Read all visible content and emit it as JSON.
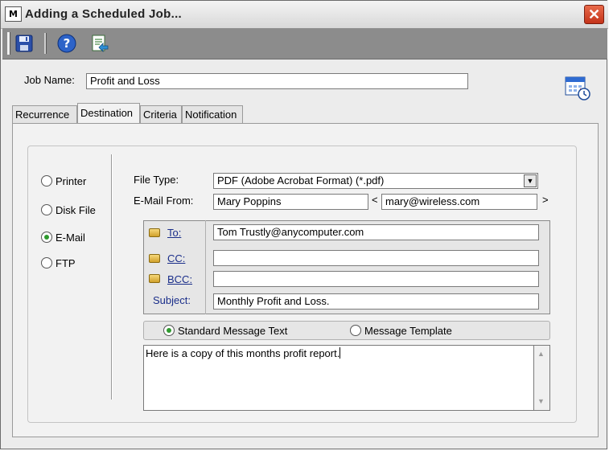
{
  "window": {
    "title": "Adding a Scheduled Job...",
    "app_icon_text": "M",
    "close_glyph": "✕"
  },
  "toolbar": {
    "buttons": [
      {
        "name": "save-icon",
        "tooltip": ""
      },
      {
        "name": "help-icon",
        "tooltip": ""
      },
      {
        "name": "export-icon",
        "tooltip": ""
      }
    ]
  },
  "job": {
    "label": "Job Name:",
    "value": "Profit and Loss"
  },
  "tabs": [
    {
      "label": "Recurrence",
      "active": false
    },
    {
      "label": "Destination",
      "active": true
    },
    {
      "label": "Criteria",
      "active": false
    },
    {
      "label": "Notification",
      "active": false
    }
  ],
  "destination": {
    "options": [
      {
        "label": "Printer",
        "checked": false
      },
      {
        "label": "Disk File",
        "checked": false
      },
      {
        "label": "E-Mail",
        "checked": true
      },
      {
        "label": "FTP",
        "checked": false
      }
    ]
  },
  "file_type": {
    "label": "File Type:",
    "value": "PDF (Adobe Acrobat Format) (*.pdf)"
  },
  "email_from": {
    "label": "E-Mail From:",
    "name": "Mary Poppins",
    "open_bracket": "<",
    "address": "mary@wireless.com",
    "close_bracket": ">"
  },
  "recipients": {
    "to": {
      "label": "To:",
      "value": "Tom Trustly@anycomputer.com"
    },
    "cc": {
      "label": "CC:",
      "value": ""
    },
    "bcc": {
      "label": "BCC:",
      "value": ""
    },
    "subject": {
      "label": "Subject:",
      "value": "Monthly Profit and Loss."
    }
  },
  "message": {
    "standard_label": "Standard Message Text",
    "standard_checked": true,
    "template_label": "Message Template",
    "template_checked": false,
    "body": "Here is a copy of this months profit report."
  },
  "colors": {
    "radio_checked": "#2e9a2e",
    "link_label": "#1a2e8a",
    "close_button": "#c4331a",
    "toolbar_bg": "#8c8c8c"
  }
}
